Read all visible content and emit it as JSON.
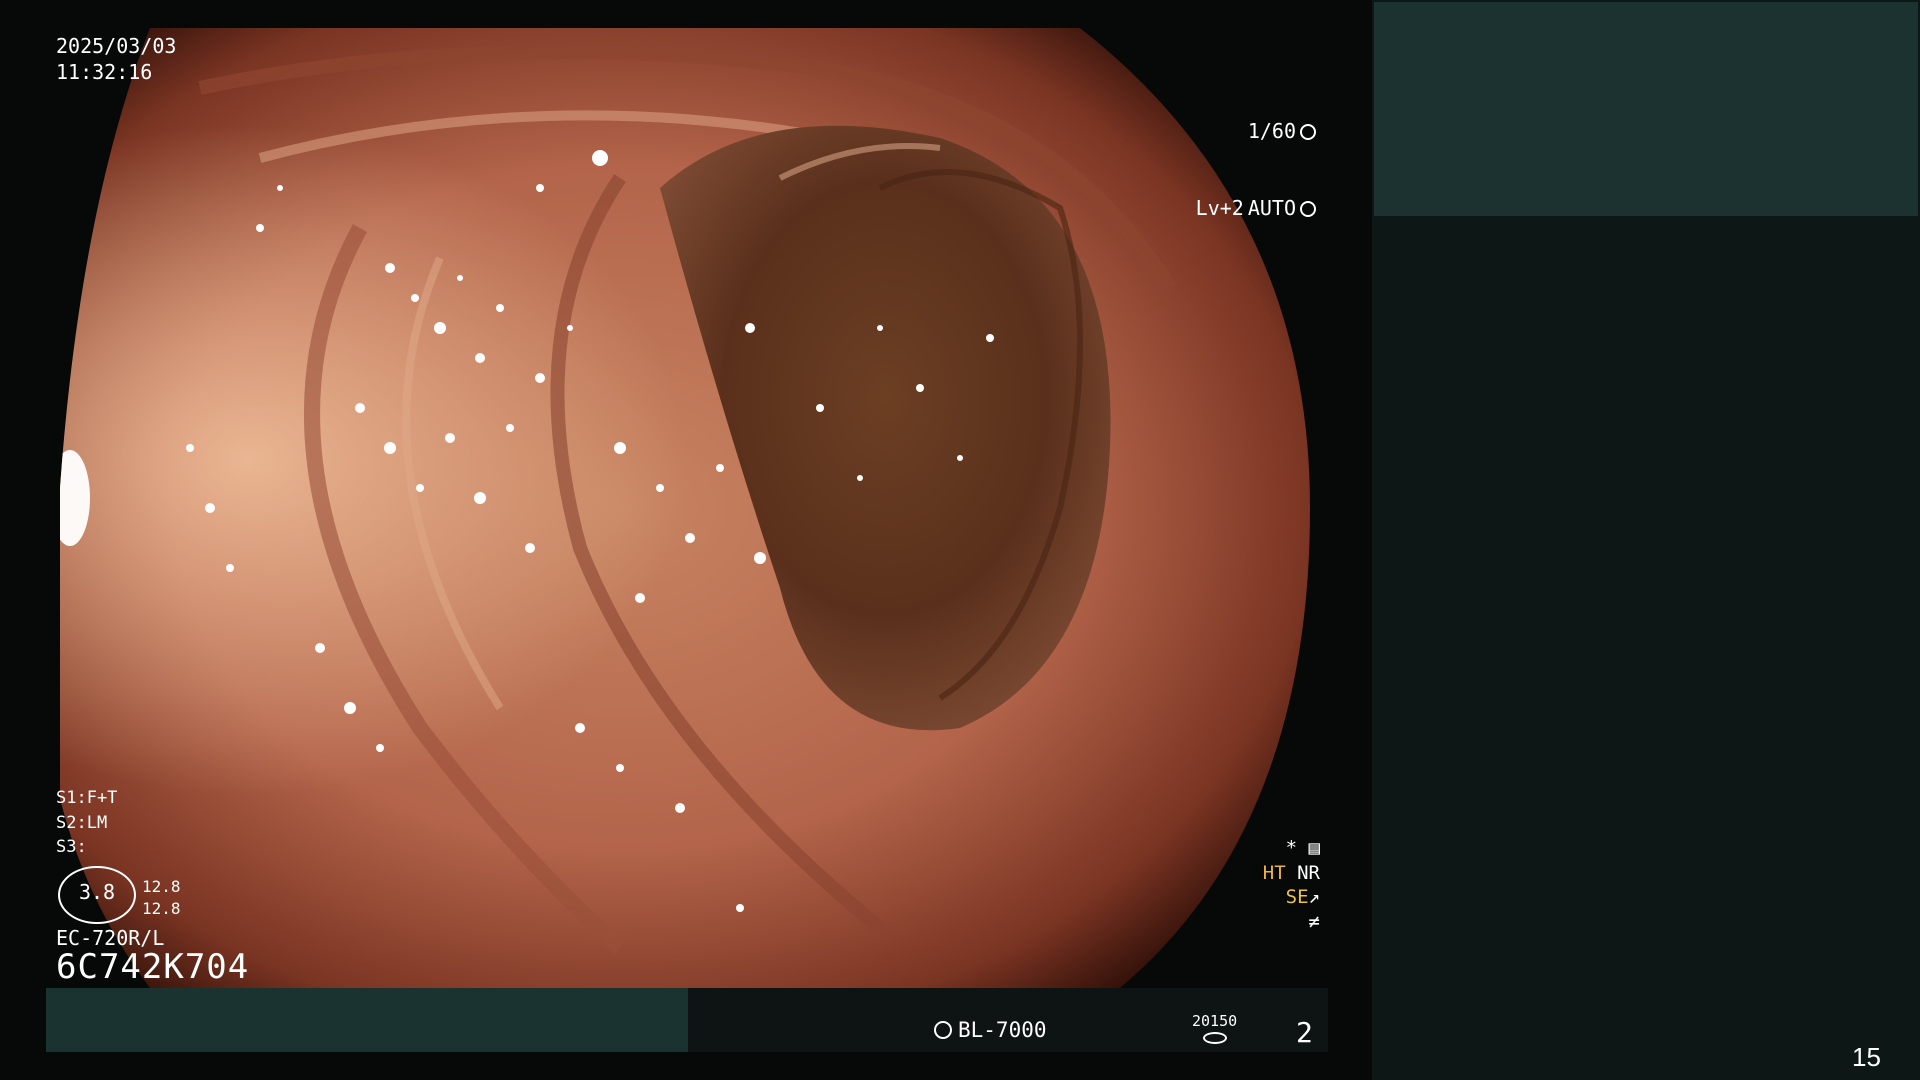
{
  "header": {
    "date": "2025/03/03",
    "time": "11:32:16"
  },
  "exposure": {
    "shutter": "1/60",
    "level": "Lv+2",
    "mode": "AUTO"
  },
  "scope_settings": {
    "s1": "S1:F+T",
    "s2": "S2:LM",
    "s3": "S3:"
  },
  "dial": {
    "value": "3.8",
    "upper": "12.8",
    "lower": "12.8"
  },
  "scope": {
    "model": "EC-720R/L",
    "serial": "6C742K704"
  },
  "right_osd": {
    "ht": "HT",
    "nr": "NR",
    "se": "SE"
  },
  "footer": {
    "light_source": "BL-7000",
    "counter": "20150",
    "image_count": "2"
  },
  "slide": {
    "page": "15"
  },
  "colors": {
    "side_panel": "#0d1716",
    "side_panel_top": "#1c3230",
    "bottom_bar_left": "#1b3330",
    "ht_label": "#f0b43a"
  },
  "icons": [
    "shutter-icon",
    "auto-icon",
    "settings-icon",
    "light-source-icon",
    "storage-icon",
    "dial-icon"
  ]
}
